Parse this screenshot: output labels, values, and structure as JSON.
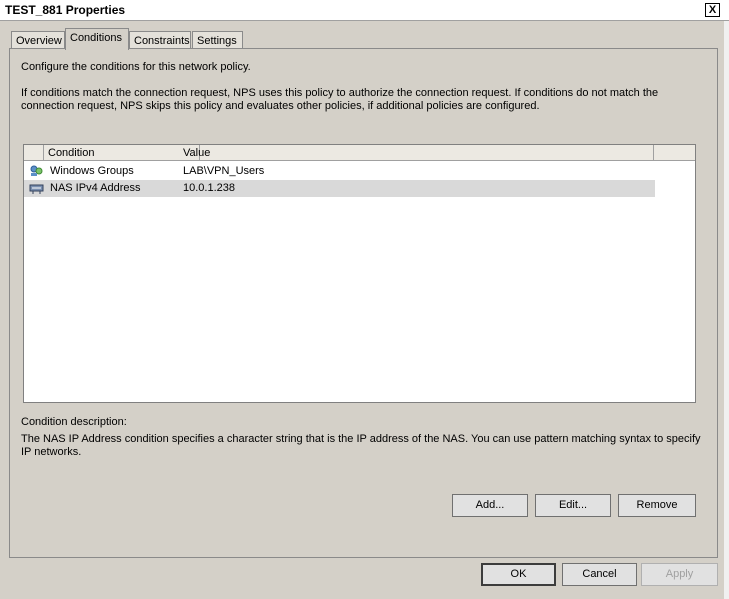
{
  "window": {
    "title": "TEST_881 Properties"
  },
  "tabs": [
    {
      "label": "Overview"
    },
    {
      "label": "Conditions"
    },
    {
      "label": "Constraints"
    },
    {
      "label": "Settings"
    }
  ],
  "active_tab": "Conditions",
  "conditions_page": {
    "intro": "Configure the conditions for this network policy.",
    "explanation": "If conditions match the connection request, NPS uses this policy to authorize the connection request. If conditions do not match the connection request, NPS skips this policy and evaluates other policies, if additional policies are configured.",
    "list": {
      "columns": [
        "Condition",
        "Value"
      ],
      "rows": [
        {
          "condition": "Windows Groups",
          "value": "LAB\\VPN_Users",
          "icon": "windows-groups-icon",
          "selected": false
        },
        {
          "condition": "NAS IPv4 Address",
          "value": "10.0.1.238",
          "icon": "nas-address-icon",
          "selected": true
        }
      ]
    },
    "description_label": "Condition description:",
    "description_text": "The NAS IP Address condition specifies a character string that is the IP address of the NAS. You can use pattern matching syntax to specify IP networks.",
    "buttons": {
      "add": "Add...",
      "edit": "Edit...",
      "remove": "Remove"
    }
  },
  "dialog_buttons": {
    "ok": "OK",
    "cancel": "Cancel",
    "apply": "Apply",
    "apply_enabled": false
  },
  "close_glyph": "X"
}
